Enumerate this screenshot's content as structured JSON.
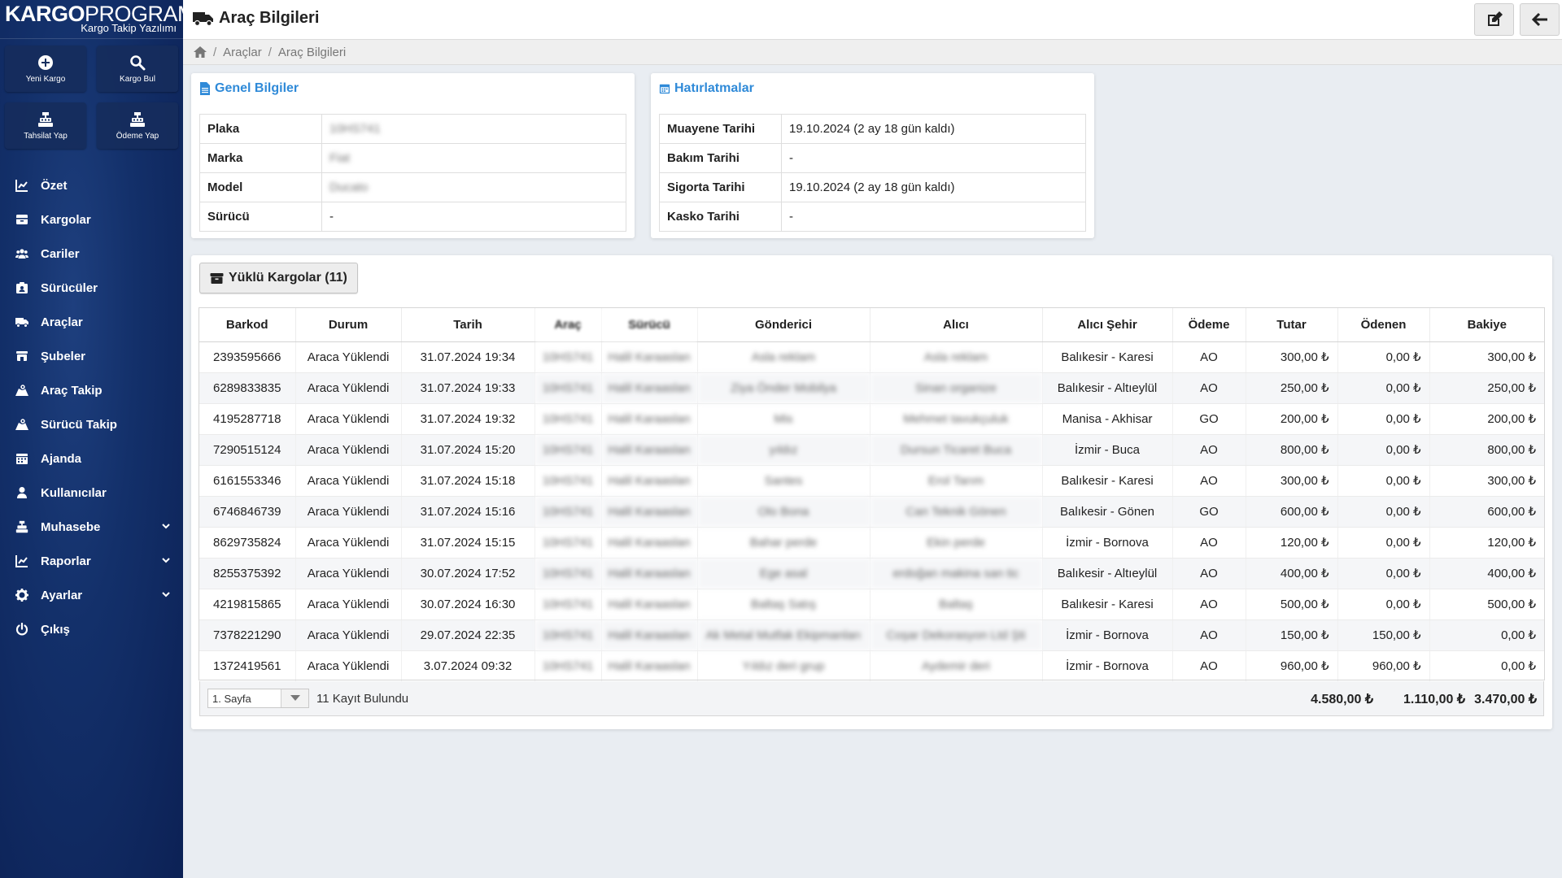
{
  "sidebar": {
    "logo_bold": "KARGO",
    "logo_light": "PROGRAMI",
    "logo_sub": "Kargo Takip Yazılımı",
    "quick": [
      "Yeni Kargo",
      "Kargo Bul",
      "Tahsilat Yap",
      "Ödeme Yap"
    ],
    "menu": [
      "Özet",
      "Kargolar",
      "Cariler",
      "Sürücüler",
      "Araçlar",
      "Şubeler",
      "Araç Takip",
      "Sürücü Takip",
      "Ajanda",
      "Kullanıcılar",
      "Muhasebe",
      "Raporlar",
      "Ayarlar",
      "Çıkış"
    ]
  },
  "header": {
    "title": "Araç Bilgileri"
  },
  "breadcrumb": {
    "items": [
      "Araçlar",
      "Araç Bilgileri"
    ]
  },
  "general": {
    "title": "Genel Bilgiler",
    "rows": [
      {
        "k": "Plaka",
        "v": "10HS741"
      },
      {
        "k": "Marka",
        "v": "Fiat"
      },
      {
        "k": "Model",
        "v": "Ducato"
      },
      {
        "k": "Sürücü",
        "v": "-"
      }
    ]
  },
  "reminders": {
    "title": "Hatırlatmalar",
    "rows": [
      {
        "k": "Muayene Tarihi",
        "v": "19.10.2024 (2 ay 18 gün kaldı)"
      },
      {
        "k": "Bakım Tarihi",
        "v": "-"
      },
      {
        "k": "Sigorta Tarihi",
        "v": "19.10.2024 (2 ay 18 gün kaldı)"
      },
      {
        "k": "Kasko Tarihi",
        "v": "-"
      }
    ]
  },
  "cargo": {
    "button_label": "Yüklü Kargolar (11)",
    "columns": [
      "Barkod",
      "Durum",
      "Tarih",
      "Araç",
      "Sürücü",
      "Gönderici",
      "Alıcı",
      "Alıcı Şehir",
      "Ödeme",
      "Tutar",
      "Ödenen",
      "Bakiye"
    ],
    "rows": [
      [
        "2393595666",
        "Araca Yüklendi",
        "31.07.2024 19:34",
        "10HS741",
        "Halil Karaaslan",
        "Asla reklam",
        "Asla reklam",
        "Balıkesir - Karesi",
        "AO",
        "300,00 ₺",
        "0,00 ₺",
        "300,00 ₺"
      ],
      [
        "6289833835",
        "Araca Yüklendi",
        "31.07.2024 19:33",
        "10HS741",
        "Halil Karaaslan",
        "Ziya Önder Mobilya",
        "Sinan organize",
        "Balıkesir - Altıeylül",
        "AO",
        "250,00 ₺",
        "0,00 ₺",
        "250,00 ₺"
      ],
      [
        "4195287718",
        "Araca Yüklendi",
        "31.07.2024 19:32",
        "10HS741",
        "Halil Karaaslan",
        "Mis",
        "Mehmet tavukçuluk",
        "Manisa - Akhisar",
        "GO",
        "200,00 ₺",
        "0,00 ₺",
        "200,00 ₺"
      ],
      [
        "7290515124",
        "Araca Yüklendi",
        "31.07.2024 15:20",
        "10HS741",
        "Halil Karaaslan",
        "yıldız",
        "Dursun Ticaret Buca",
        "İzmir - Buca",
        "AO",
        "800,00 ₺",
        "0,00 ₺",
        "800,00 ₺"
      ],
      [
        "6161553346",
        "Araca Yüklendi",
        "31.07.2024 15:18",
        "10HS741",
        "Halil Karaaslan",
        "Santes",
        "Erol Tarım",
        "Balıkesir - Karesi",
        "AO",
        "300,00 ₺",
        "0,00 ₺",
        "300,00 ₺"
      ],
      [
        "6746846739",
        "Araca Yüklendi",
        "31.07.2024 15:16",
        "10HS741",
        "Halil Karaaslan",
        "Olo Bona",
        "Can Teknik Gönen",
        "Balıkesir - Gönen",
        "GO",
        "600,00 ₺",
        "0,00 ₺",
        "600,00 ₺"
      ],
      [
        "8629735824",
        "Araca Yüklendi",
        "31.07.2024 15:15",
        "10HS741",
        "Halil Karaaslan",
        "Bahar perde",
        "Ekin perde",
        "İzmir - Bornova",
        "AO",
        "120,00 ₺",
        "0,00 ₺",
        "120,00 ₺"
      ],
      [
        "8255375392",
        "Araca Yüklendi",
        "30.07.2024 17:52",
        "10HS741",
        "Halil Karaaslan",
        "Ege asal",
        "erdoğan makina san tic",
        "Balıkesir - Altıeylül",
        "AO",
        "400,00 ₺",
        "0,00 ₺",
        "400,00 ₺"
      ],
      [
        "4219815865",
        "Araca Yüklendi",
        "30.07.2024 16:30",
        "10HS741",
        "Halil Karaaslan",
        "Baltaş Satış",
        "Baltaş",
        "Balıkesir - Karesi",
        "AO",
        "500,00 ₺",
        "0,00 ₺",
        "500,00 ₺"
      ],
      [
        "7378221290",
        "Araca Yüklendi",
        "29.07.2024 22:35",
        "10HS741",
        "Halil Karaaslan",
        "Ak Metal Mutfak Ekipmanları",
        "Coşar Dekorasyon Ltd Şti",
        "İzmir - Bornova",
        "AO",
        "150,00 ₺",
        "150,00 ₺",
        "0,00 ₺"
      ],
      [
        "1372419561",
        "Araca Yüklendi",
        "3.07.2024 09:32",
        "10HS741",
        "Halil Karaaslan",
        "Yıldız deri grup",
        "Aydemir deri",
        "İzmir - Bornova",
        "AO",
        "960,00 ₺",
        "960,00 ₺",
        "0,00 ₺"
      ]
    ],
    "page_select": "1. Sayfa",
    "found_label": "11 Kayıt Bulundu",
    "totals": {
      "tutar": "4.580,00 ₺",
      "odenen": "1.110,00 ₺",
      "bakiye": "3.470,00 ₺"
    }
  }
}
